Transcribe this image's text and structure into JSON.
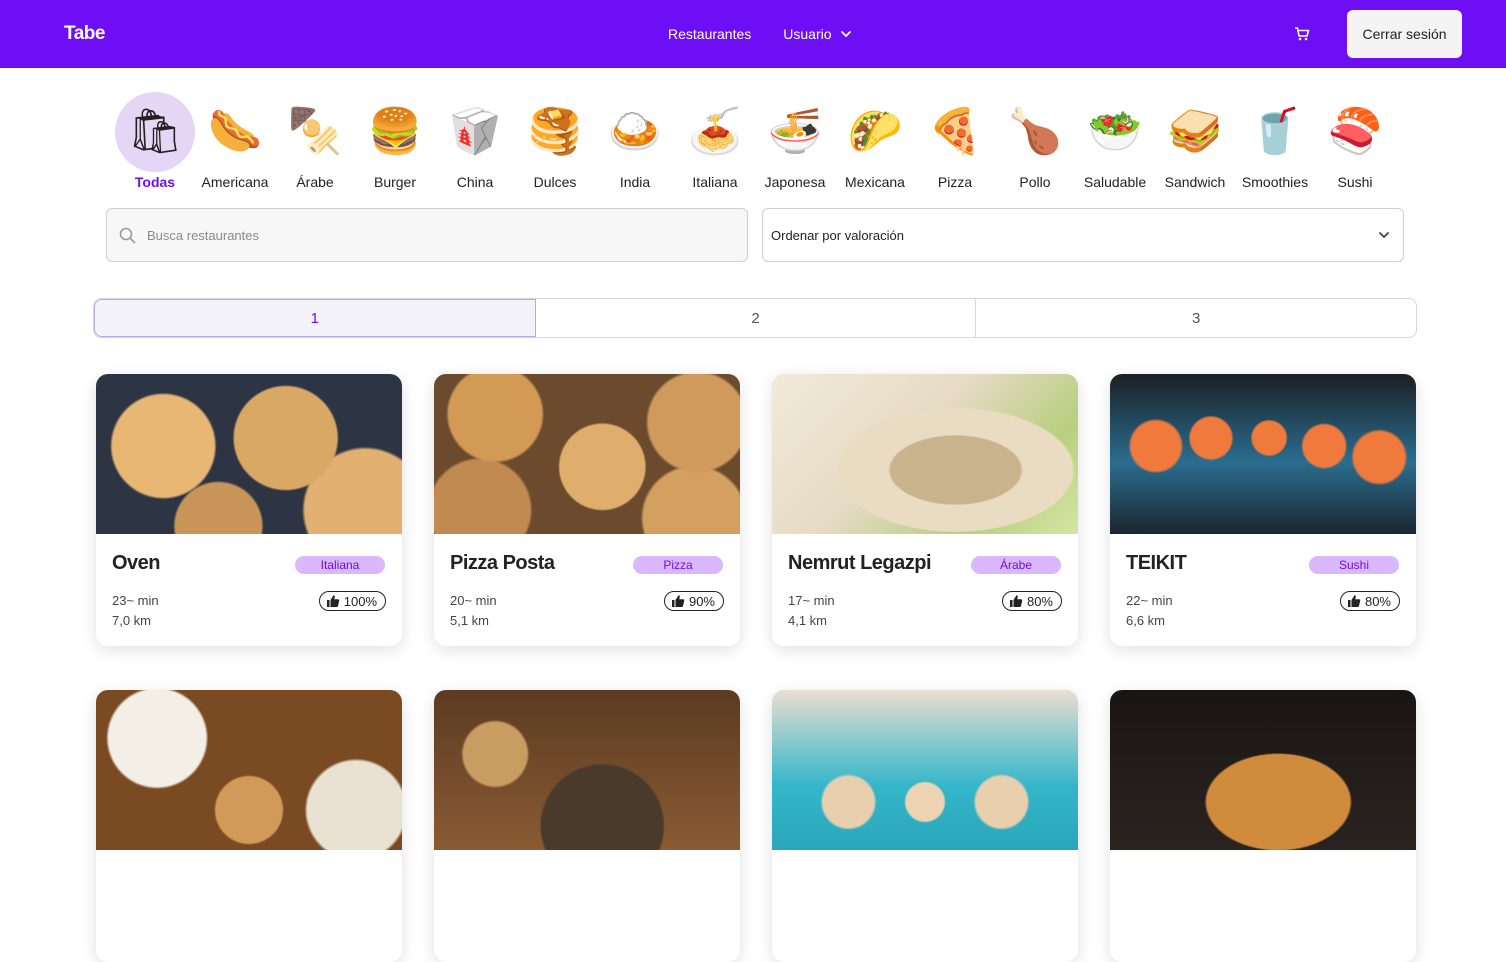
{
  "header": {
    "logo": "Tabe",
    "nav": [
      "Restaurantes",
      "Usuario"
    ],
    "logout": "Cerrar sesión",
    "brand_color": "#6e0ef5"
  },
  "categories": [
    {
      "label": "Todas",
      "icon": "grocery-bag-icon",
      "glyph": "🛍",
      "active": true
    },
    {
      "label": "Americana",
      "icon": "hotdog-icon",
      "glyph": "🌭"
    },
    {
      "label": "Árabe",
      "icon": "kebab-skewer-icon",
      "glyph": "🍢"
    },
    {
      "label": "Burger",
      "icon": "burger-icon",
      "glyph": "🍔"
    },
    {
      "label": "China",
      "icon": "takeout-box-icon",
      "glyph": "🥡"
    },
    {
      "label": "Dulces",
      "icon": "pancakes-icon",
      "glyph": "🥞"
    },
    {
      "label": "India",
      "icon": "curry-icon",
      "glyph": "🍛"
    },
    {
      "label": "Italiana",
      "icon": "spaghetti-icon",
      "glyph": "🍝"
    },
    {
      "label": "Japonesa",
      "icon": "ramen-icon",
      "glyph": "🍜"
    },
    {
      "label": "Mexicana",
      "icon": "taco-icon",
      "glyph": "🌮"
    },
    {
      "label": "Pizza",
      "icon": "pizza-icon",
      "glyph": "🍕"
    },
    {
      "label": "Pollo",
      "icon": "chicken-bucket-icon",
      "glyph": "🍗"
    },
    {
      "label": "Saludable",
      "icon": "salad-bowl-icon",
      "glyph": "🥗"
    },
    {
      "label": "Sandwich",
      "icon": "sandwich-icon",
      "glyph": "🥪"
    },
    {
      "label": "Smoothies",
      "icon": "smoothie-cup-icon",
      "glyph": "🥤"
    },
    {
      "label": "Sushi",
      "icon": "sushi-icon",
      "glyph": "🍣"
    }
  ],
  "search": {
    "placeholder": "Busca restaurantes",
    "value": ""
  },
  "sort": {
    "label": "Ordenar por valoración"
  },
  "pagination": {
    "pages": [
      "1",
      "2",
      "3"
    ],
    "active": "1"
  },
  "restaurants": [
    {
      "name": "Oven",
      "category": "Italiana",
      "time": "23~ min",
      "distance": "7,0 km",
      "rating": "100%",
      "image": "pizza-photo"
    },
    {
      "name": "Pizza Posta",
      "category": "Pizza",
      "time": "20~ min",
      "distance": "5,1 km",
      "rating": "90%",
      "image": "pizza-table-photo"
    },
    {
      "name": "Nemrut Legazpi",
      "category": "Árabe",
      "time": "17~ min",
      "distance": "4,1 km",
      "rating": "80%",
      "image": "kebab-wrap-photo"
    },
    {
      "name": "TEIKIT",
      "category": "Sushi",
      "time": "22~ min",
      "distance": "6,6 km",
      "rating": "80%",
      "image": "sushi-rolls-photo"
    },
    {
      "image": "mezze-platter-photo"
    },
    {
      "image": "falafel-plate-photo"
    },
    {
      "image": "cinnamon-rolls-photo"
    },
    {
      "image": "crispy-noodles-photo"
    }
  ]
}
